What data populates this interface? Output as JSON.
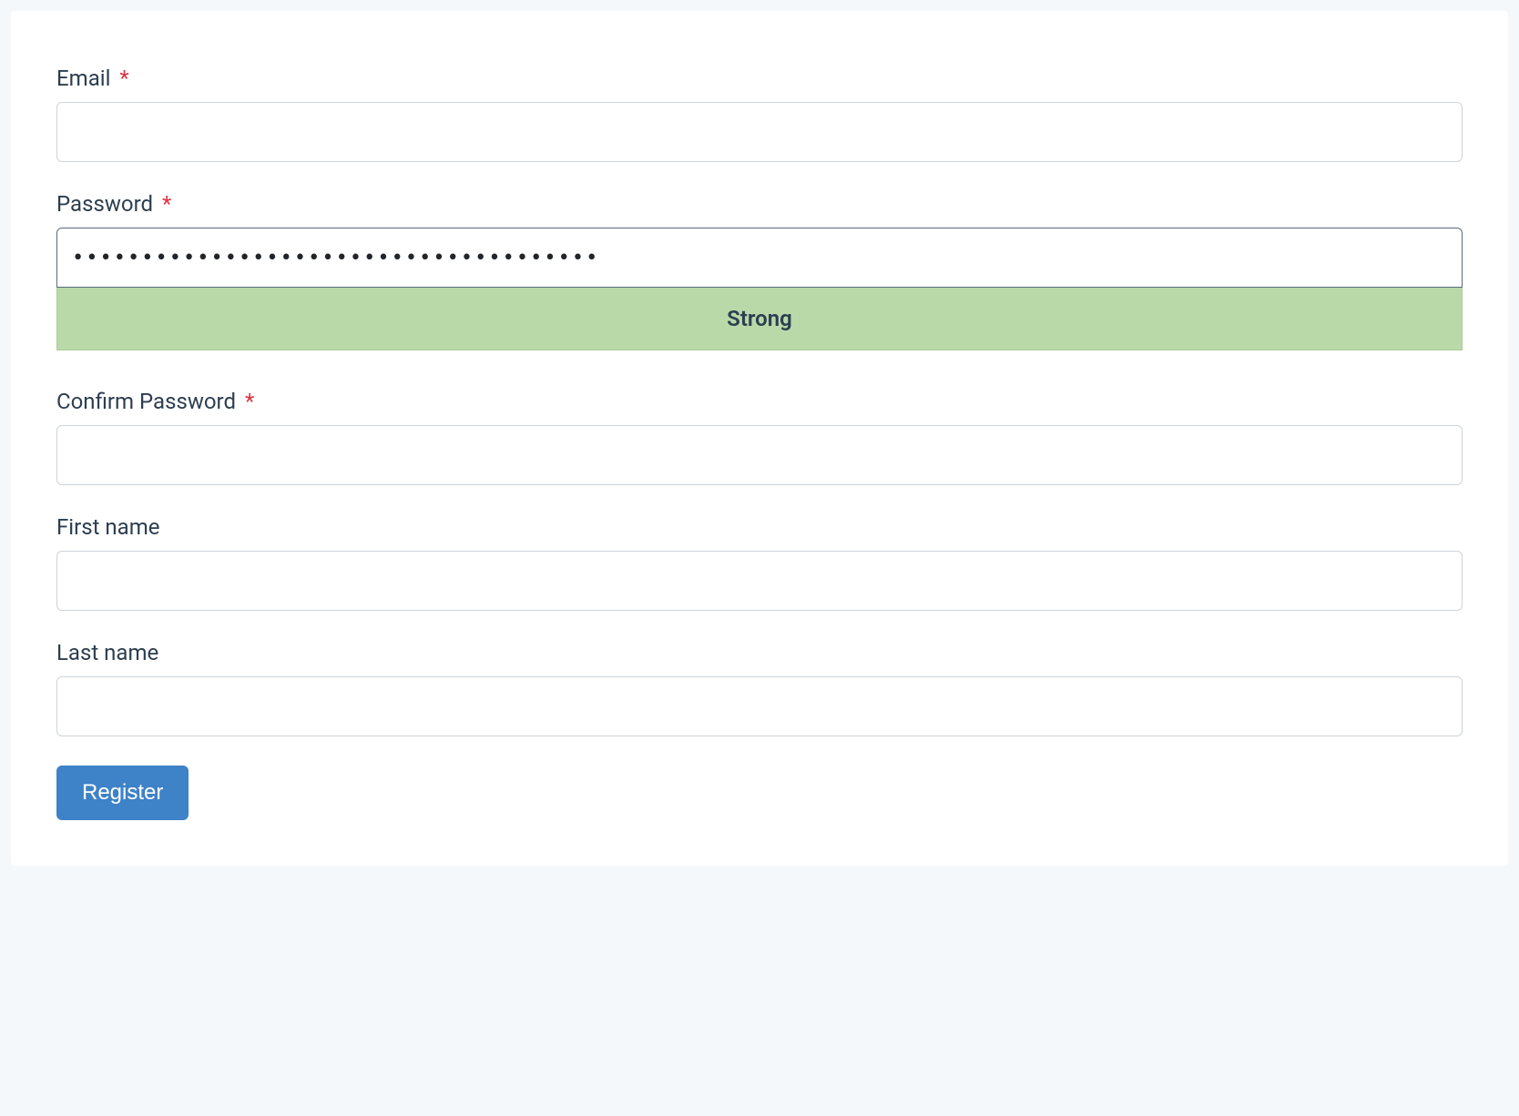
{
  "form": {
    "email": {
      "label": "Email",
      "required": true,
      "value": ""
    },
    "password": {
      "label": "Password",
      "required": true,
      "value": "••••••••••••••••••••••••••••••••••••••",
      "strength_label": "Strong"
    },
    "confirm_password": {
      "label": "Confirm Password",
      "required": true,
      "value": ""
    },
    "first_name": {
      "label": "First name",
      "required": false,
      "value": ""
    },
    "last_name": {
      "label": "Last name",
      "required": false,
      "value": ""
    },
    "submit_label": "Register",
    "required_marker": "*"
  }
}
